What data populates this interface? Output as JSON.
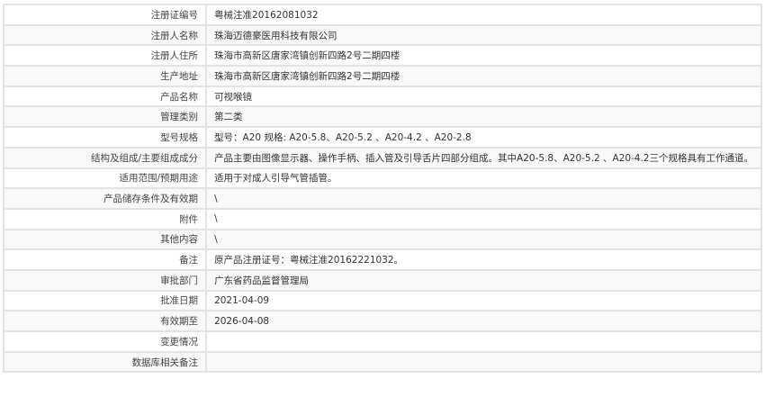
{
  "rows": [
    {
      "label": "注册证编号",
      "value": "粤械注准20162081032"
    },
    {
      "label": "注册人名称",
      "value": "珠海迈德豪医用科技有限公司"
    },
    {
      "label": "注册人住所",
      "value": "珠海市高新区唐家湾镇创新四路2号二期四楼"
    },
    {
      "label": "生产地址",
      "value": "珠海市高新区唐家湾镇创新四路2号二期四楼"
    },
    {
      "label": "产品名称",
      "value": "可视喉镜"
    },
    {
      "label": "管理类别",
      "value": "第二类"
    },
    {
      "label": "型号规格",
      "value": "型号：A20 规格: A20-5.8、A20-5.2 、A20-4.2 、A20-2.8"
    },
    {
      "label": "结构及组成/主要组成成分",
      "value": "产品主要由图像显示器、操作手柄、插入管及引导舌片四部分组成。其中A20-5.8、A20-5.2 、A20-4.2三个规格具有工作通道。"
    },
    {
      "label": "适用范围/预期用途",
      "value": "适用于对成人引导气管插管。"
    },
    {
      "label": "产品储存条件及有效期",
      "value": "\\"
    },
    {
      "label": "附件",
      "value": "\\"
    },
    {
      "label": "其他内容",
      "value": "\\"
    },
    {
      "label": "备注",
      "value": "原产品注册证号：粤械注准20162221032。"
    },
    {
      "label": "审批部门",
      "value": "广东省药品监督管理局"
    },
    {
      "label": "批准日期",
      "value": "2021-04-09"
    },
    {
      "label": "有效期至",
      "value": "2026-04-08"
    },
    {
      "label": "变更情况",
      "value": ""
    },
    {
      "label": "数据库相关备注",
      "value": ""
    }
  ]
}
